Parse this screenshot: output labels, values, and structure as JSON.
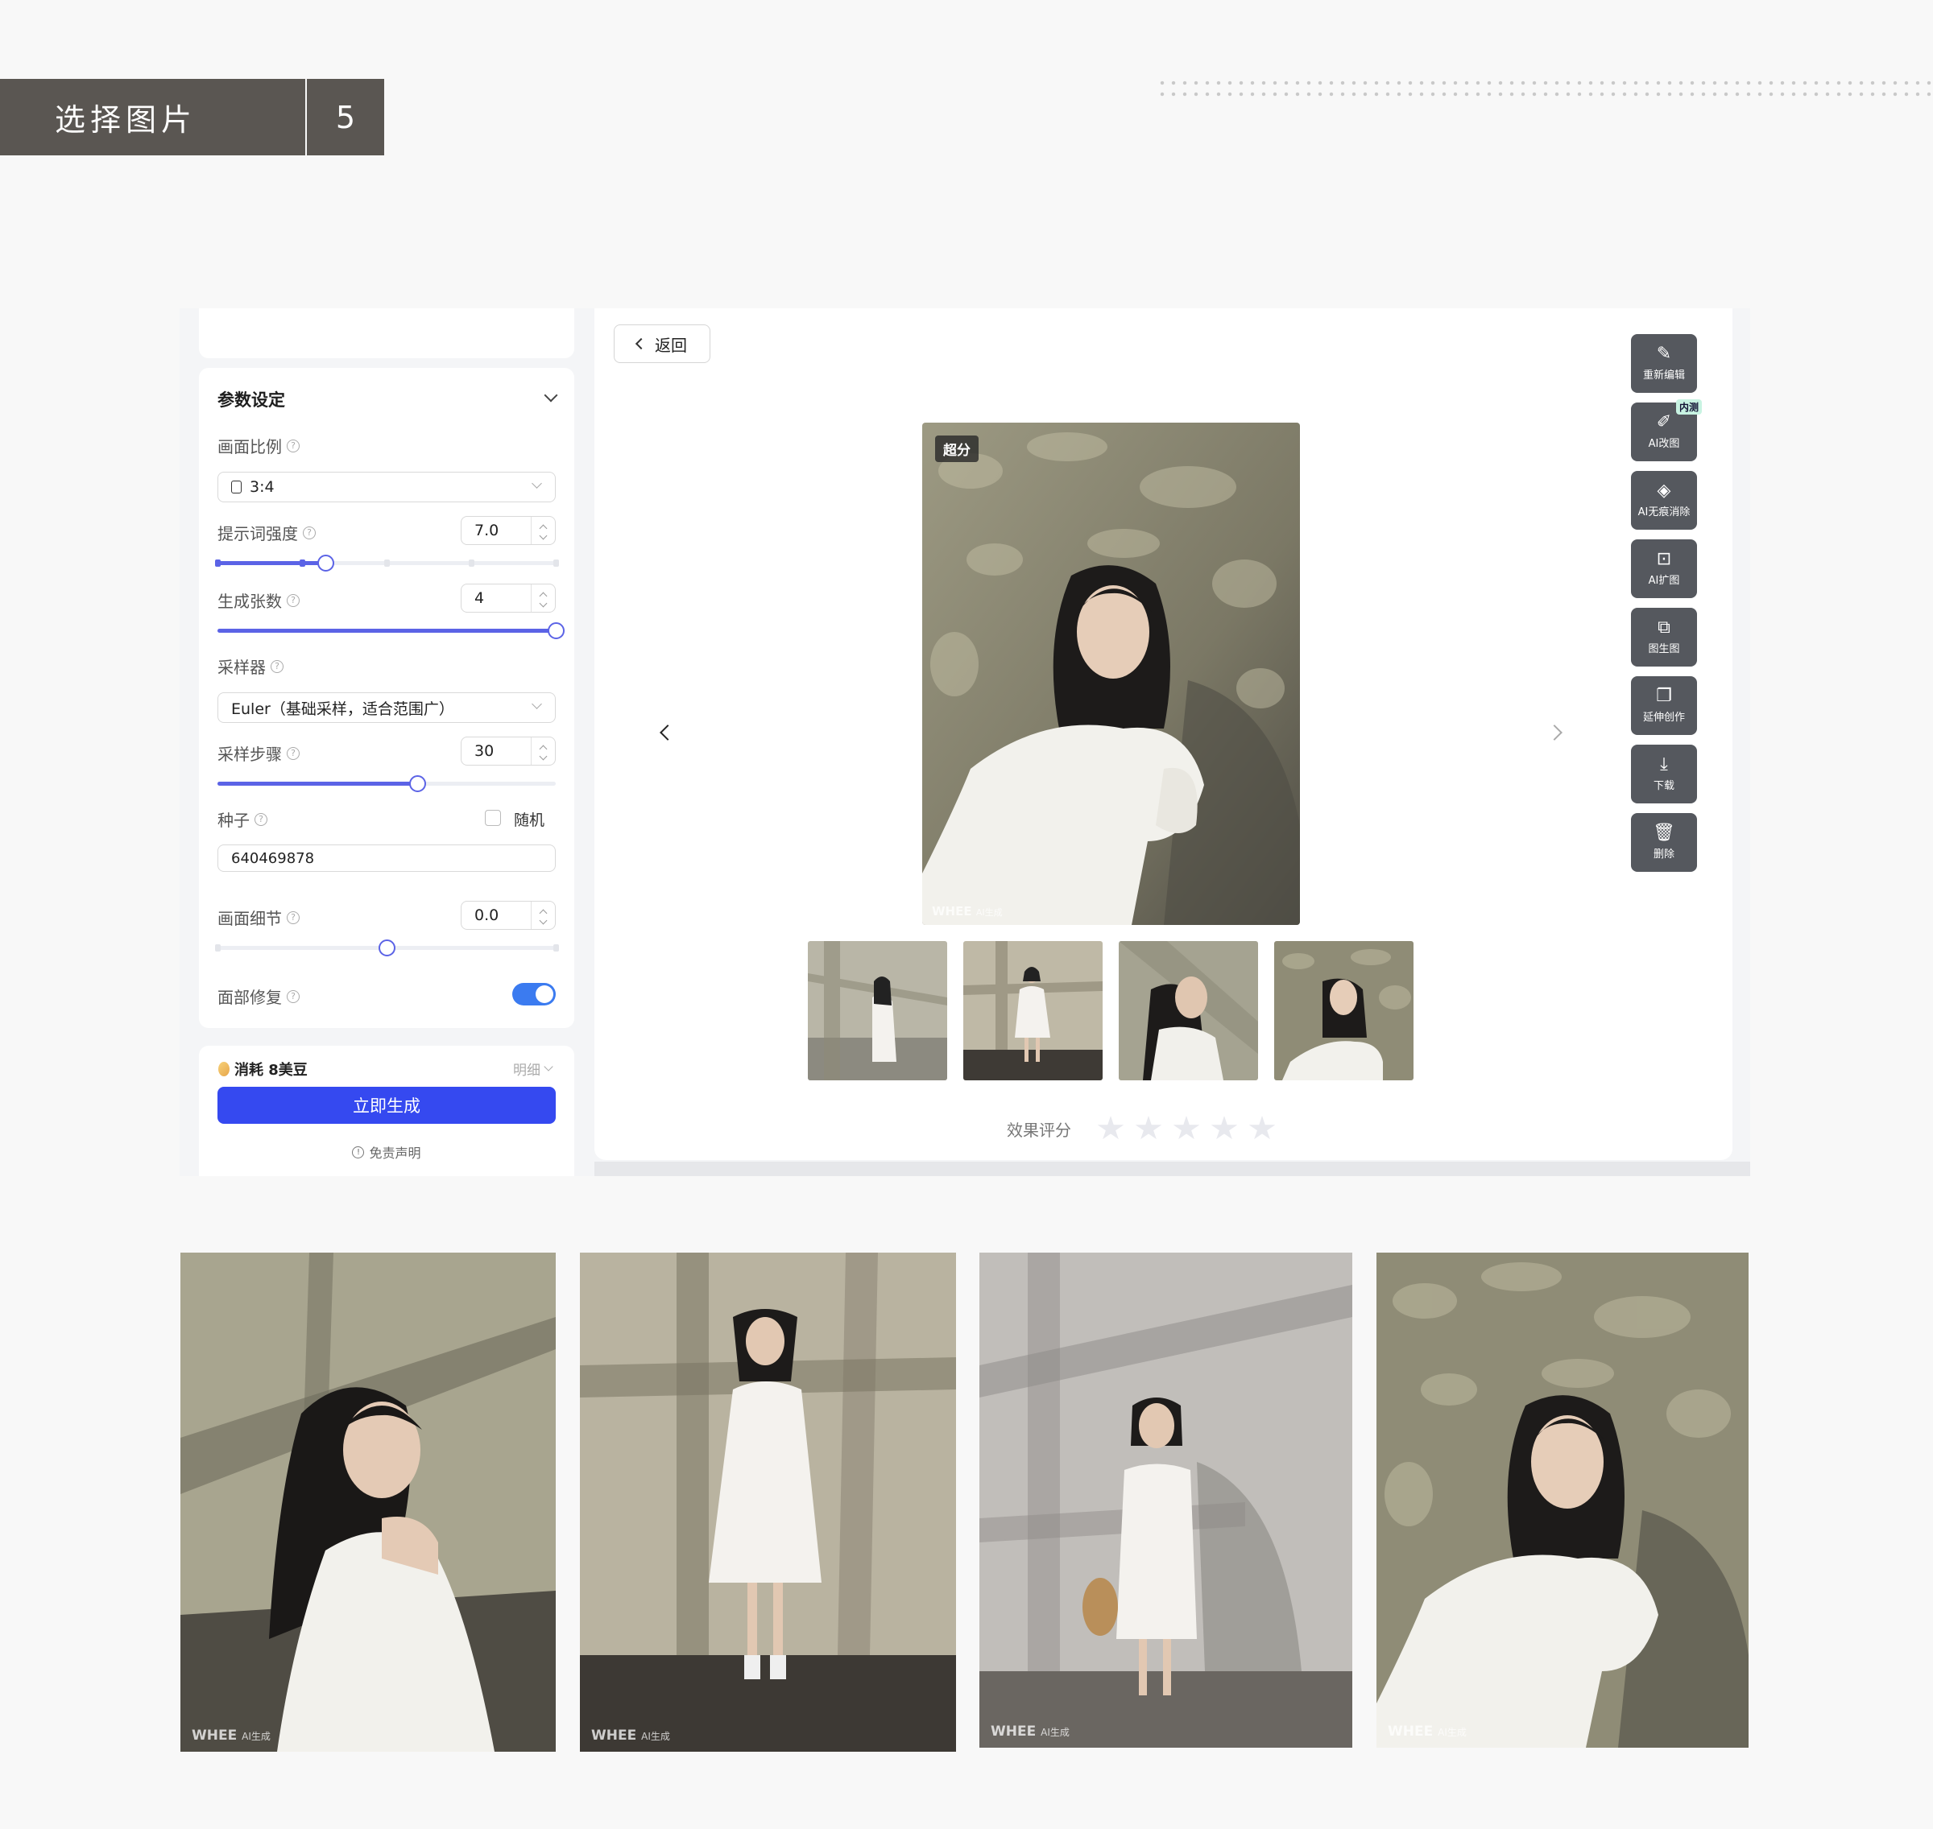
{
  "header": {
    "title": "选择图片",
    "step": "5"
  },
  "params": {
    "section_title": "参数设定",
    "aspect": {
      "label": "画面比例",
      "value": "3:4"
    },
    "prompt_strength": {
      "label": "提示词强度",
      "value": "7.0",
      "fraction": 0.32
    },
    "count": {
      "label": "生成张数",
      "value": "4",
      "fraction": 1.0
    },
    "sampler": {
      "label": "采样器",
      "value": "Euler（基础采样，适合范围广）"
    },
    "steps": {
      "label": "采样步骤",
      "value": "30",
      "fraction": 0.59
    },
    "seed": {
      "label": "种子",
      "random_label": "随机",
      "value": "640469878"
    },
    "detail": {
      "label": "画面细节",
      "value": "0.0",
      "fraction": 0.5
    },
    "face_fix": {
      "label": "面部修复",
      "enabled": true
    }
  },
  "footer": {
    "cost": "消耗 8美豆",
    "detail": "明细",
    "generate": "立即生成",
    "disclaimer": "免责声明"
  },
  "preview": {
    "back": "返回",
    "tag": "超分",
    "watermark": "WHEE",
    "watermark_sub": "AI生成",
    "rating_label": "效果评分",
    "rating_stars": 5
  },
  "tools": [
    {
      "icon": "re-edit-icon",
      "glyph": "✎",
      "label": "重新编辑"
    },
    {
      "icon": "ai-modify-icon",
      "glyph": "✐",
      "label": "AI改图",
      "badge": "内测"
    },
    {
      "icon": "eraser-icon",
      "glyph": "◈",
      "label": "AI无痕消除"
    },
    {
      "icon": "expand-icon",
      "glyph": "⊡",
      "label": "AI扩图"
    },
    {
      "icon": "image-to-image-icon",
      "glyph": "⧉",
      "label": "图生图"
    },
    {
      "icon": "extend-create-icon",
      "glyph": "❐",
      "label": "延伸创作"
    },
    {
      "icon": "download-icon",
      "glyph": "⤓",
      "label": "下载"
    },
    {
      "icon": "delete-icon",
      "glyph": "🗑",
      "label": "删除"
    }
  ],
  "colors": {
    "accent": "#3549f0",
    "slider": "#5b63e6",
    "toggle": "#3b7bf0",
    "header_bg": "#5a5652"
  }
}
